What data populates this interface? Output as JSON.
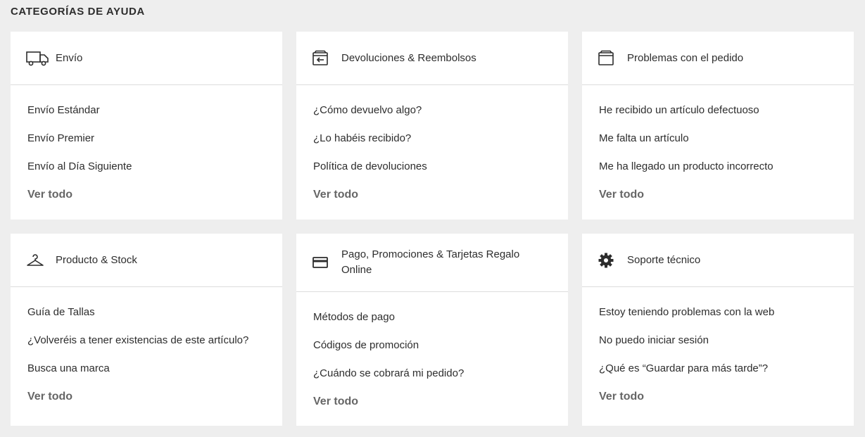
{
  "page": {
    "title": "CATEGORÍAS DE AYUDA"
  },
  "see_all_label": "Ver todo",
  "categories": [
    {
      "title": "Envío",
      "icon": "truck-icon",
      "links": [
        "Envío Estándar",
        "Envío Premier",
        "Envío al Día Siguiente"
      ]
    },
    {
      "title": "Devoluciones & Reembolsos",
      "icon": "return-box-icon",
      "links": [
        "¿Cómo devuelvo algo?",
        "¿Lo habéis recibido?",
        "Política de devoluciones"
      ]
    },
    {
      "title": "Problemas con el pedido",
      "icon": "box-icon",
      "links": [
        "He recibido un artículo defectuoso",
        "Me falta un artículo",
        "Me ha llegado un producto incorrecto"
      ]
    },
    {
      "title": "Producto & Stock",
      "icon": "hanger-icon",
      "links": [
        "Guía de Tallas",
        "¿Volveréis a tener existencias de este artículo?",
        "Busca una marca"
      ]
    },
    {
      "title": "Pago, Promociones & Tarjetas Regalo Online",
      "icon": "credit-card-icon",
      "links": [
        "Métodos de pago",
        "Códigos de promoción",
        "¿Cuándo se cobrará mi pedido?"
      ]
    },
    {
      "title": "Soporte técnico",
      "icon": "gear-icon",
      "links": [
        "Estoy teniendo problemas con la web",
        "No puedo iniciar sesión",
        "¿Qué es “Guardar para más tarde”?"
      ]
    }
  ]
}
